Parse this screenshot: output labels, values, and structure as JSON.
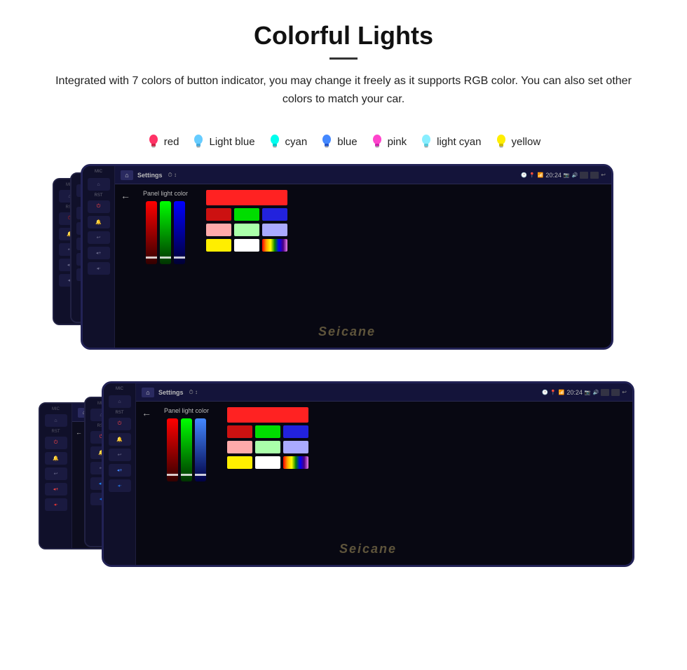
{
  "page": {
    "title": "Colorful Lights",
    "divider": true,
    "description": "Integrated with 7 colors of button indicator, you may change it freely as it supports RGB color. You can also set other colors to match your car.",
    "colors": [
      {
        "name": "red",
        "hex": "#ff3366",
        "label": "red"
      },
      {
        "name": "light-blue",
        "hex": "#66ccff",
        "label": "Light blue"
      },
      {
        "name": "cyan",
        "hex": "#00ffee",
        "label": "cyan"
      },
      {
        "name": "blue",
        "hex": "#4488ff",
        "label": "blue"
      },
      {
        "name": "pink",
        "hex": "#ff44cc",
        "label": "pink"
      },
      {
        "name": "light-cyan",
        "hex": "#88eeff",
        "label": "light cyan"
      },
      {
        "name": "yellow",
        "hex": "#ffee00",
        "label": "yellow"
      }
    ],
    "device_top": {
      "settings_label": "Settings",
      "back_label": "←",
      "home_label": "⌂",
      "time": "20:24",
      "panel_label": "Panel light color",
      "watermark": "Seicane"
    },
    "device_bottom": {
      "settings_label": "Settings",
      "back_label": "←",
      "home_label": "⌂",
      "time": "20:24",
      "panel_label": "Panel light color",
      "watermark": "Seicane"
    },
    "color_grid_top": {
      "row1": [
        "#ff0000"
      ],
      "row2": [
        "#cc0000",
        "#00dd00",
        "#0000dd"
      ],
      "row3": [
        "#ffaaaa",
        "#aaffaa",
        "#aaaaff"
      ],
      "row4": [
        "#ffff00",
        "#ffffff",
        "rainbow"
      ]
    },
    "color_grid_bottom": {
      "row1": [
        "#ff0000"
      ],
      "row2": [
        "#cc0000",
        "#00dd00",
        "#0000dd"
      ],
      "row3": [
        "#ffaaaa",
        "#aaffaa",
        "#aaaaff"
      ],
      "row4": [
        "#ffff00",
        "#ffffff",
        "rainbow"
      ]
    }
  }
}
